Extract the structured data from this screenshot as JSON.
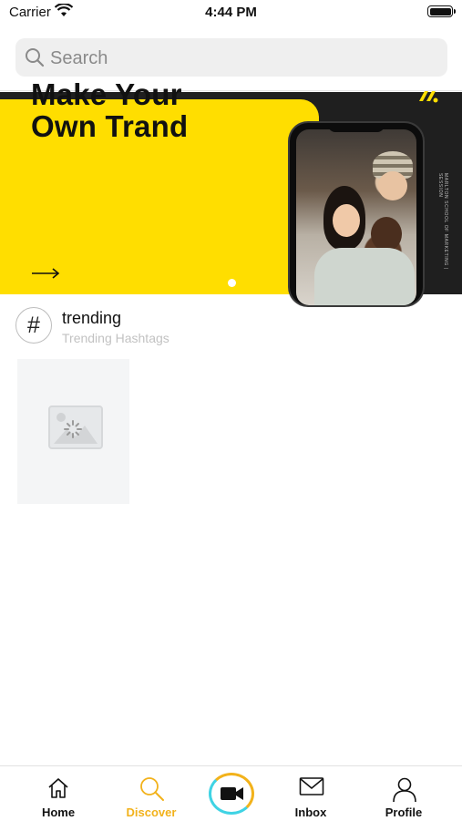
{
  "status_bar": {
    "carrier": "Carrier",
    "time": "4:44 PM"
  },
  "search": {
    "placeholder": "Search"
  },
  "banner": {
    "headline_line1": "Make Your",
    "headline_line2": "Own Trand",
    "side_text": "MARLTON SCHOOL OF MARKETING | SESSION",
    "page_index": 1,
    "page_count": 1
  },
  "hashtag": {
    "symbol": "#",
    "title": "trending",
    "subtitle": "Trending Hashtags"
  },
  "tabs": [
    {
      "label": "Home",
      "icon": "home-icon"
    },
    {
      "label": "Discover",
      "icon": "search-icon",
      "active": true
    },
    {
      "label": "",
      "icon": "video-camera-icon"
    },
    {
      "label": "Inbox",
      "icon": "envelope-icon"
    },
    {
      "label": "Profile",
      "icon": "user-icon"
    }
  ],
  "colors": {
    "accent": "#f2b21b",
    "banner_yellow": "#ffde00",
    "record_ring_secondary": "#3fd3e4"
  }
}
